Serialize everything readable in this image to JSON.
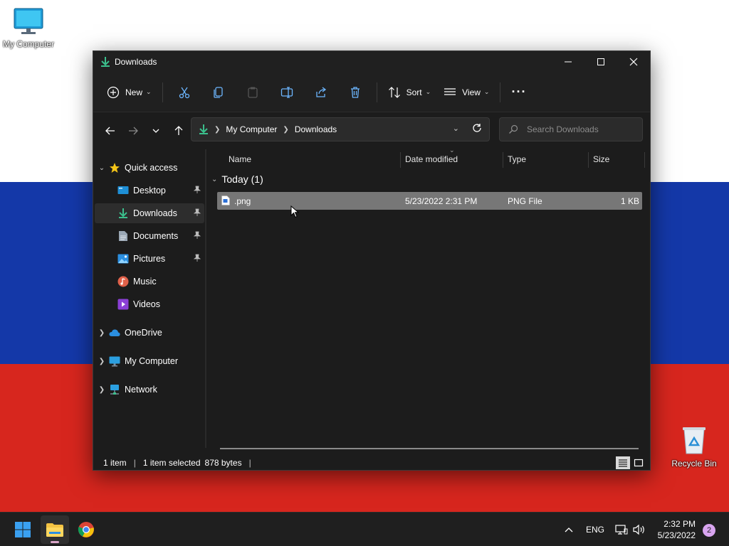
{
  "desktop": {
    "icons": [
      {
        "label": "My Computer",
        "icon": "monitor-icon"
      },
      {
        "label": "Recycle Bin",
        "icon": "recycle-bin-icon"
      }
    ]
  },
  "window": {
    "title": "Downloads",
    "controls": {
      "minimize": "minimize",
      "maximize": "maximize",
      "close": "close"
    }
  },
  "toolbar": {
    "new_label": "New",
    "sort_label": "Sort",
    "view_label": "View",
    "more_label": "···"
  },
  "address": {
    "crumbs": [
      "My Computer",
      "Downloads"
    ],
    "search_placeholder": "Search Downloads"
  },
  "sidebar": {
    "quick_access": "Quick access",
    "items": [
      {
        "label": "Desktop",
        "pinned": true
      },
      {
        "label": "Downloads",
        "pinned": true,
        "active": true
      },
      {
        "label": "Documents",
        "pinned": true
      },
      {
        "label": "Pictures",
        "pinned": true
      },
      {
        "label": "Music",
        "pinned": false
      },
      {
        "label": "Videos",
        "pinned": false
      }
    ],
    "roots": [
      "OneDrive",
      "My Computer",
      "Network"
    ]
  },
  "list": {
    "columns": [
      "Name",
      "Date modified",
      "Type",
      "Size"
    ],
    "group_label": "Today (1)",
    "rows": [
      {
        "name": ".png",
        "date": "5/23/2022 2:31 PM",
        "type": "PNG File",
        "size": "1 KB",
        "selected": true
      }
    ]
  },
  "status": {
    "count": "1 item",
    "selected": "1 item selected",
    "size": "878 bytes"
  },
  "taskbar": {
    "lang": "ENG",
    "time": "2:32 PM",
    "date": "5/23/2022",
    "notifications": "2"
  },
  "colors": {
    "flag_white": "#ffffff",
    "flag_blue": "#1438a8",
    "flag_red": "#d7261e",
    "window_bg": "#1c1c1c",
    "selection": "#777777",
    "accent_green": "#3bbf8c"
  }
}
